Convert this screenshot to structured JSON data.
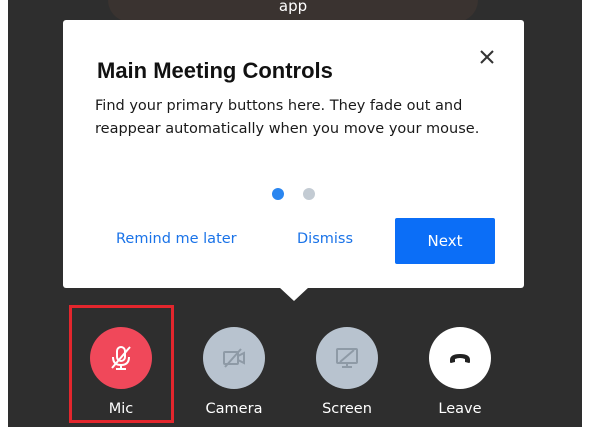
{
  "banner": {
    "text": "app"
  },
  "popup": {
    "title": "Main Meeting Controls",
    "body": "Find your primary buttons here. They fade out and reappear automatically when you move your mouse.",
    "remind_label": "Remind me later",
    "dismiss_label": "Dismiss",
    "next_label": "Next",
    "close_icon": "close-icon",
    "pagination": {
      "total": 2,
      "active": 1
    }
  },
  "controls": [
    {
      "label": "Mic",
      "icon": "mic-muted-icon",
      "color": "#f0485a",
      "highlighted": true
    },
    {
      "label": "Camera",
      "icon": "camera-off-icon",
      "color": "#b8c3cf"
    },
    {
      "label": "Screen",
      "icon": "screen-share-off-icon",
      "color": "#b8c3cf"
    },
    {
      "label": "Leave",
      "icon": "hang-up-icon",
      "color": "#ffffff"
    }
  ],
  "colors": {
    "accent": "#0b6ef7",
    "highlight": "#e3262d",
    "background": "#2e2e2e"
  }
}
